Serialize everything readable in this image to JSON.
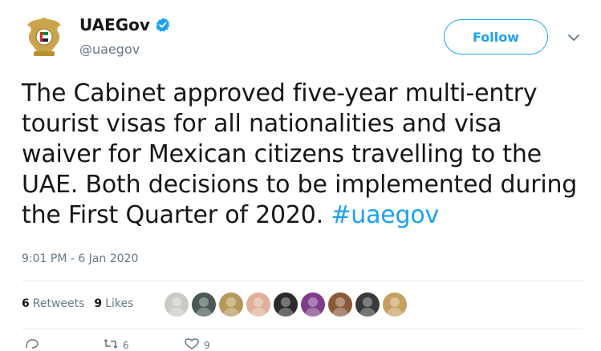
{
  "account": {
    "display_name": "UAEGov",
    "handle": "@uaegov",
    "verified": true,
    "avatar_icon": "uae-emblem-icon"
  },
  "follow_button": {
    "label": "Follow"
  },
  "menu_caret_icon": "chevron-down-icon",
  "tweet": {
    "text": "The Cabinet approved five-year multi-entry tourist visas for all nationalities and visa waiver for Mexican citizens travelling to the UAE. Both decisions to be implemented during the First Quarter of 2020.",
    "hashtag": "#uaegov",
    "timestamp": "9:01 PM - 6 Jan 2020"
  },
  "stats": {
    "retweets_count": "6",
    "retweets_label": "Retweets",
    "likes_count": "9",
    "likes_label": "Likes"
  },
  "likers": [
    {
      "icon": "liker-avatar-1",
      "color": "#c9cbc6"
    },
    {
      "icon": "liker-avatar-2",
      "color": "#4a5a52"
    },
    {
      "icon": "liker-avatar-3",
      "color": "#b49a5a"
    },
    {
      "icon": "liker-avatar-4",
      "color": "#e0b09a"
    },
    {
      "icon": "liker-avatar-5",
      "color": "#2b2b2b"
    },
    {
      "icon": "liker-avatar-6",
      "color": "#7e3d8a"
    },
    {
      "icon": "liker-avatar-7",
      "color": "#8a5a38"
    },
    {
      "icon": "liker-avatar-8",
      "color": "#3a3a3a"
    },
    {
      "icon": "liker-avatar-9",
      "color": "#c7a060"
    }
  ],
  "colors": {
    "accent": "#1da1f2",
    "text": "#14171a",
    "muted": "#657786",
    "divider": "#e6ecf0"
  }
}
